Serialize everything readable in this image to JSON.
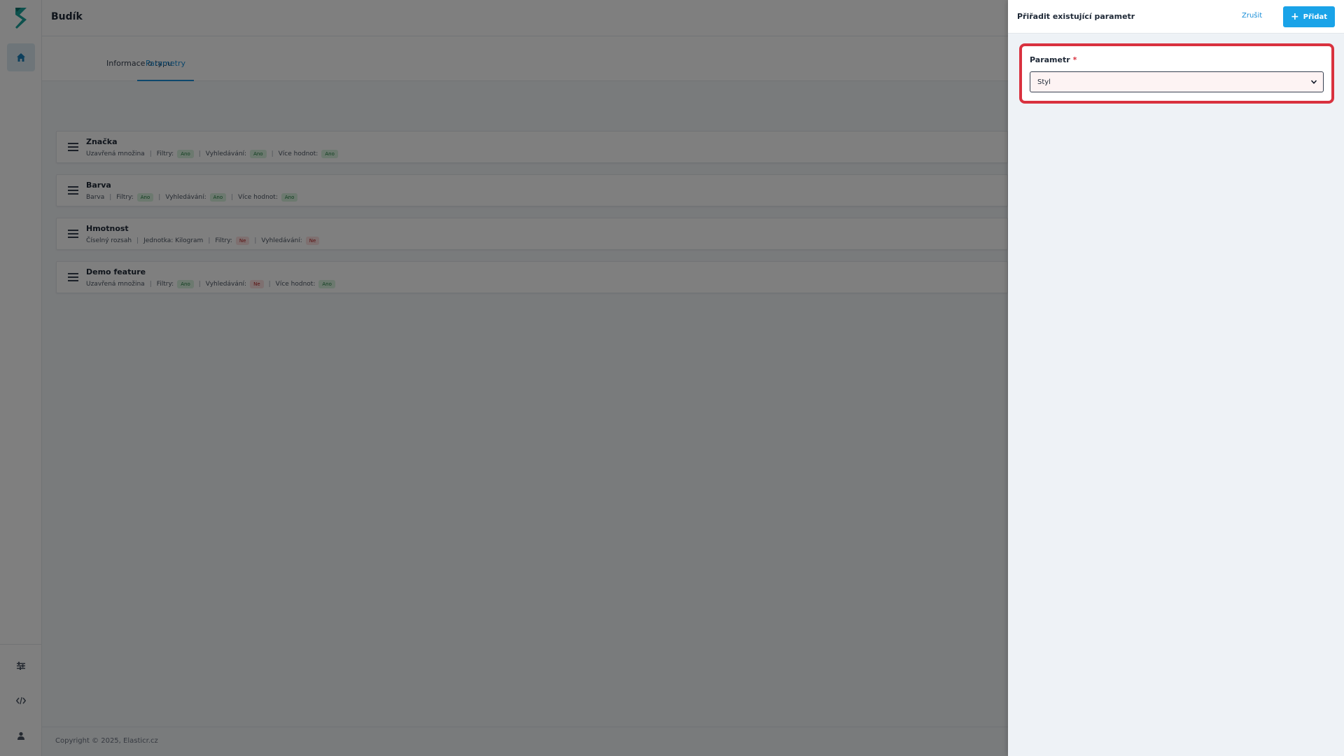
{
  "header": {
    "title": "Budík"
  },
  "tabs": [
    {
      "label": "Informace o typu",
      "active": false
    },
    {
      "label": "Parametry",
      "active": true
    }
  ],
  "parameters": [
    {
      "name": "Značka",
      "meta": [
        {
          "text": "Uzavřená množina"
        },
        {
          "text": "Filtry:",
          "badge": "Ano",
          "badge_type": "yes"
        },
        {
          "text": "Vyhledávání:",
          "badge": "Ano",
          "badge_type": "yes"
        },
        {
          "text": "Více hodnot:",
          "badge": "Ano",
          "badge_type": "yes"
        }
      ]
    },
    {
      "name": "Barva",
      "meta": [
        {
          "text": "Barva"
        },
        {
          "text": "Filtry:",
          "badge": "Ano",
          "badge_type": "yes"
        },
        {
          "text": "Vyhledávání:",
          "badge": "Ano",
          "badge_type": "yes"
        },
        {
          "text": "Více hodnot:",
          "badge": "Ano",
          "badge_type": "yes"
        }
      ]
    },
    {
      "name": "Hmotnost",
      "meta": [
        {
          "text": "Číselný rozsah"
        },
        {
          "text": "Jednotka: Kilogram"
        },
        {
          "text": "Filtry:",
          "badge": "Ne",
          "badge_type": "no"
        },
        {
          "text": "Vyhledávání:",
          "badge": "Ne",
          "badge_type": "no"
        }
      ]
    },
    {
      "name": "Demo feature",
      "meta": [
        {
          "text": "Uzavřená množina"
        },
        {
          "text": "Filtry:",
          "badge": "Ano",
          "badge_type": "yes"
        },
        {
          "text": "Vyhledávání:",
          "badge": "Ne",
          "badge_type": "no"
        },
        {
          "text": "Více hodnot:",
          "badge": "Ano",
          "badge_type": "yes"
        }
      ]
    }
  ],
  "footer": {
    "copyright": "Copyright © 2025, Elasticr.cz"
  },
  "drawer": {
    "title": "Přiřadit existující parametr",
    "cancel_label": "Zrušit",
    "add_label": "Přidat",
    "field": {
      "label": "Parametr",
      "required_mark": "*",
      "selected_value": "Styl"
    }
  },
  "colors": {
    "accent": "#1aa3e8",
    "link": "#1a8fd8",
    "error_outline": "#d9323f",
    "badge_yes_bg": "#d9f2df",
    "badge_no_bg": "#fde0e0"
  },
  "icons": {
    "logo": "elasticr-logo",
    "nav_home": "home-icon",
    "nav_settings": "sliders-icon",
    "nav_code": "code-icon",
    "nav_user": "user-icon",
    "drag": "drag-handle-icon",
    "add": "plus-icon",
    "select": "chevron-down-icon"
  }
}
